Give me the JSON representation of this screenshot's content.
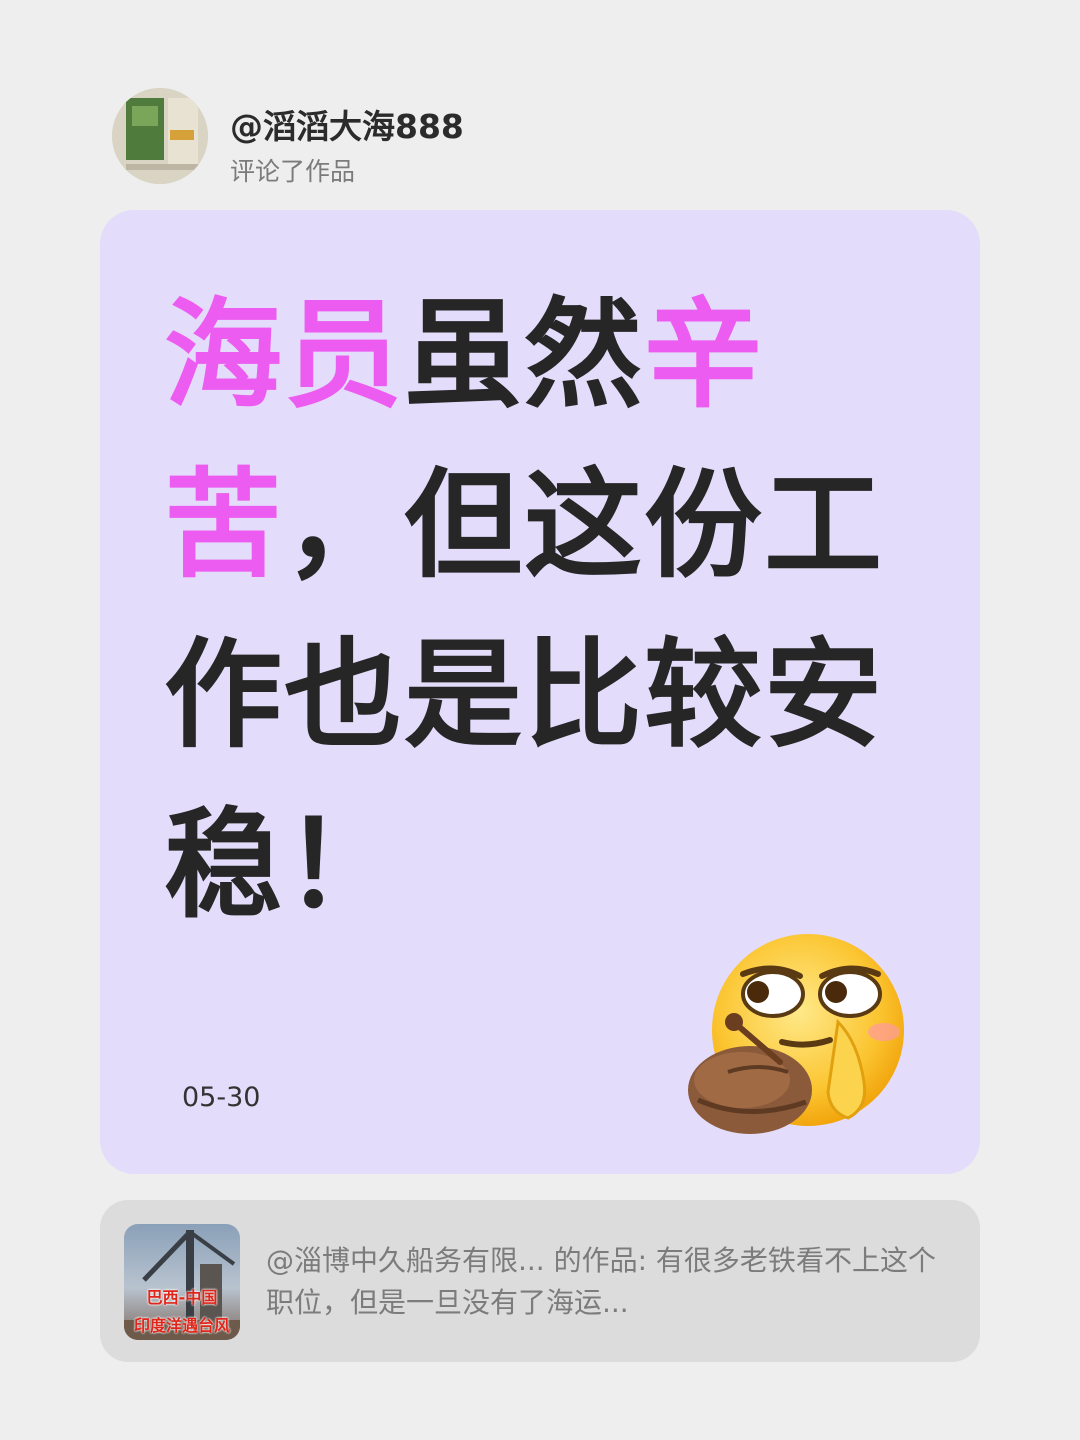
{
  "header": {
    "username": "@滔滔大海888",
    "action": "评论了作品"
  },
  "comment": {
    "parts": [
      {
        "text": "海员",
        "highlight": true
      },
      {
        "text": "虽然",
        "highlight": false
      },
      {
        "text": "辛苦",
        "highlight": true
      },
      {
        "text": "，但这份工作也是比较安稳！",
        "highlight": false
      }
    ],
    "date": "05-30",
    "emoji": "smirk-thinking-emoji"
  },
  "reference": {
    "thumbnail_caption_1": "巴西-中国",
    "thumbnail_caption_2": "印度洋遇台风",
    "text": "@淄博中久船务有限... 的作品: 有很多老铁看不上这个职位，但是一旦没有了海运..."
  },
  "colors": {
    "background": "#eeeeef",
    "card": "#e4dcfb",
    "highlight": "#ec5cf0",
    "reference_card": "#dcdcdc"
  }
}
